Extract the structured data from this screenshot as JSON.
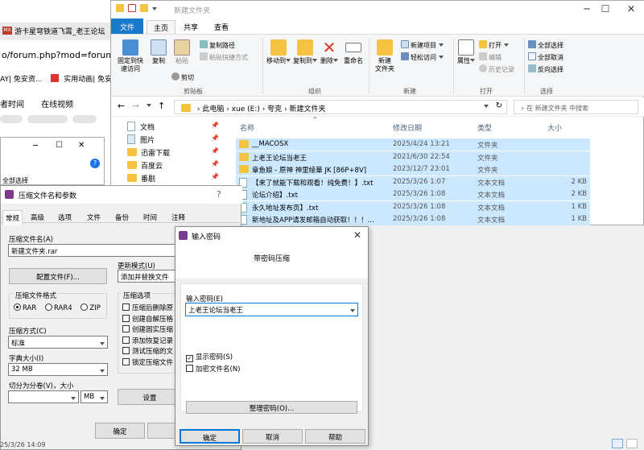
{
  "browser": {
    "tab_title": "游卡星穹铁道飞霄_老王论坛",
    "tab_logo_text": "MX",
    "url_fragment": "o/forum.php?mod=forumdis",
    "bookmarks": [
      "AY| 免安资...",
      "实用动画| 免安"
    ],
    "nav": [
      "者时间",
      "在线视频"
    ],
    "status_time": "25/3/26 14:09"
  },
  "explorer": {
    "title": "新建文件夹",
    "ribbon_tabs": [
      "文件",
      "主页",
      "共享",
      "查看"
    ],
    "active_tab": "主页",
    "clipboard": {
      "pin_quick_access": "固定到快\n速访问",
      "copy": "复制",
      "paste": "粘贴",
      "copy_path": "复制路径",
      "paste_shortcut": "粘贴快捷方式",
      "cut": "剪切",
      "group": "剪贴板"
    },
    "organize": {
      "move_to": "移动到",
      "copy_to": "复制到",
      "delete": "删除",
      "rename": "重命名",
      "group": "组织"
    },
    "new": {
      "new_folder": "新建\n文件夹",
      "new_item": "新建项目",
      "easy_access": "轻松访问",
      "group": "新建"
    },
    "open": {
      "properties": "属性",
      "open": "打开",
      "edit": "编辑",
      "history": "历史记录",
      "group": "打开"
    },
    "select": {
      "select_all": "全部选择",
      "select_none": "全部取消",
      "invert": "反向选择",
      "group": "选择"
    },
    "breadcrumb": [
      "此电脑",
      "xue (E:)",
      "夸克",
      "新建文件夹"
    ],
    "search_placeholder": "在 新建文件夹 中搜索",
    "columns": [
      "名称",
      "修改日期",
      "类型",
      "大小"
    ],
    "nav_items": [
      "文档",
      "图片",
      "迅雷下载",
      "百度云",
      "番剧"
    ],
    "files": [
      {
        "name": "__MACOSX",
        "date": "2025/4/24 13:21",
        "type": "文件夹",
        "size": "",
        "kind": "folder"
      },
      {
        "name": "上老王论坛当老王",
        "date": "2021/6/30 22:54",
        "type": "文件夹",
        "size": "",
        "kind": "folder"
      },
      {
        "name": "章鱼娘 - 原神 神里绫華 JK [86P+8V]",
        "date": "2023/12/7 23:01",
        "type": "文件夹",
        "size": "",
        "kind": "folder"
      },
      {
        "name": "【来了就能下载和观看！纯免费！】.txt",
        "date": "2025/3/26 1:07",
        "type": "文本文档",
        "size": "2 KB",
        "kind": "doc"
      },
      {
        "name": "论坛介绍】.txt",
        "date": "2025/3/26 1:08",
        "type": "文本文档",
        "size": "2 KB",
        "kind": "doc"
      },
      {
        "name": "永久地址发布页】.txt",
        "date": "2025/3/26 1:08",
        "type": "文本文档",
        "size": "1 KB",
        "kind": "doc"
      },
      {
        "name": "新地址及APP请发邮箱自动获取！！！...",
        "date": "2025/3/26 1:08",
        "type": "文本文档",
        "size": "1 KB",
        "kind": "doc"
      }
    ]
  },
  "small_window": {
    "select_all": "全部选择"
  },
  "compress_dialog": {
    "title": "压缩文件名和参数",
    "help": "?",
    "tabs": [
      "常规",
      "高级",
      "选项",
      "文件",
      "备份",
      "时间",
      "注释"
    ],
    "archive_name_label": "压缩文件名(A)",
    "archive_name": "新建文件夹.rar",
    "profiles_button": "配置文件(F)...",
    "update_mode_label": "更新模式(U)",
    "update_mode": "添加并替换文件",
    "format_label": "压缩文件格式",
    "formats": [
      "RAR",
      "RAR4",
      "ZIP"
    ],
    "method_label": "压缩方式(C)",
    "method": "标准",
    "dict_label": "字典大小(I)",
    "dict": "32 MB",
    "split_label": "切分为分卷(V)，大小",
    "split_unit": "MB",
    "options_label": "压缩选项",
    "options": [
      "压缩后删除原",
      "创建自解压格",
      "创建固实压缩",
      "添加恢复记录",
      "测试压缩的文",
      "锁定压缩文件"
    ],
    "settings_button": "设置",
    "ok_button": "确定"
  },
  "password_dialog": {
    "title": "输入密码",
    "header": "带密码压缩",
    "password_label": "输入密码(E)",
    "password_value": "上老王论坛当老王",
    "show_password": "显示密码(S)",
    "encrypt_names": "加密文件名(N)",
    "organize_button": "整理密码(O)...",
    "ok": "确定",
    "cancel": "取消",
    "help": "帮助"
  }
}
